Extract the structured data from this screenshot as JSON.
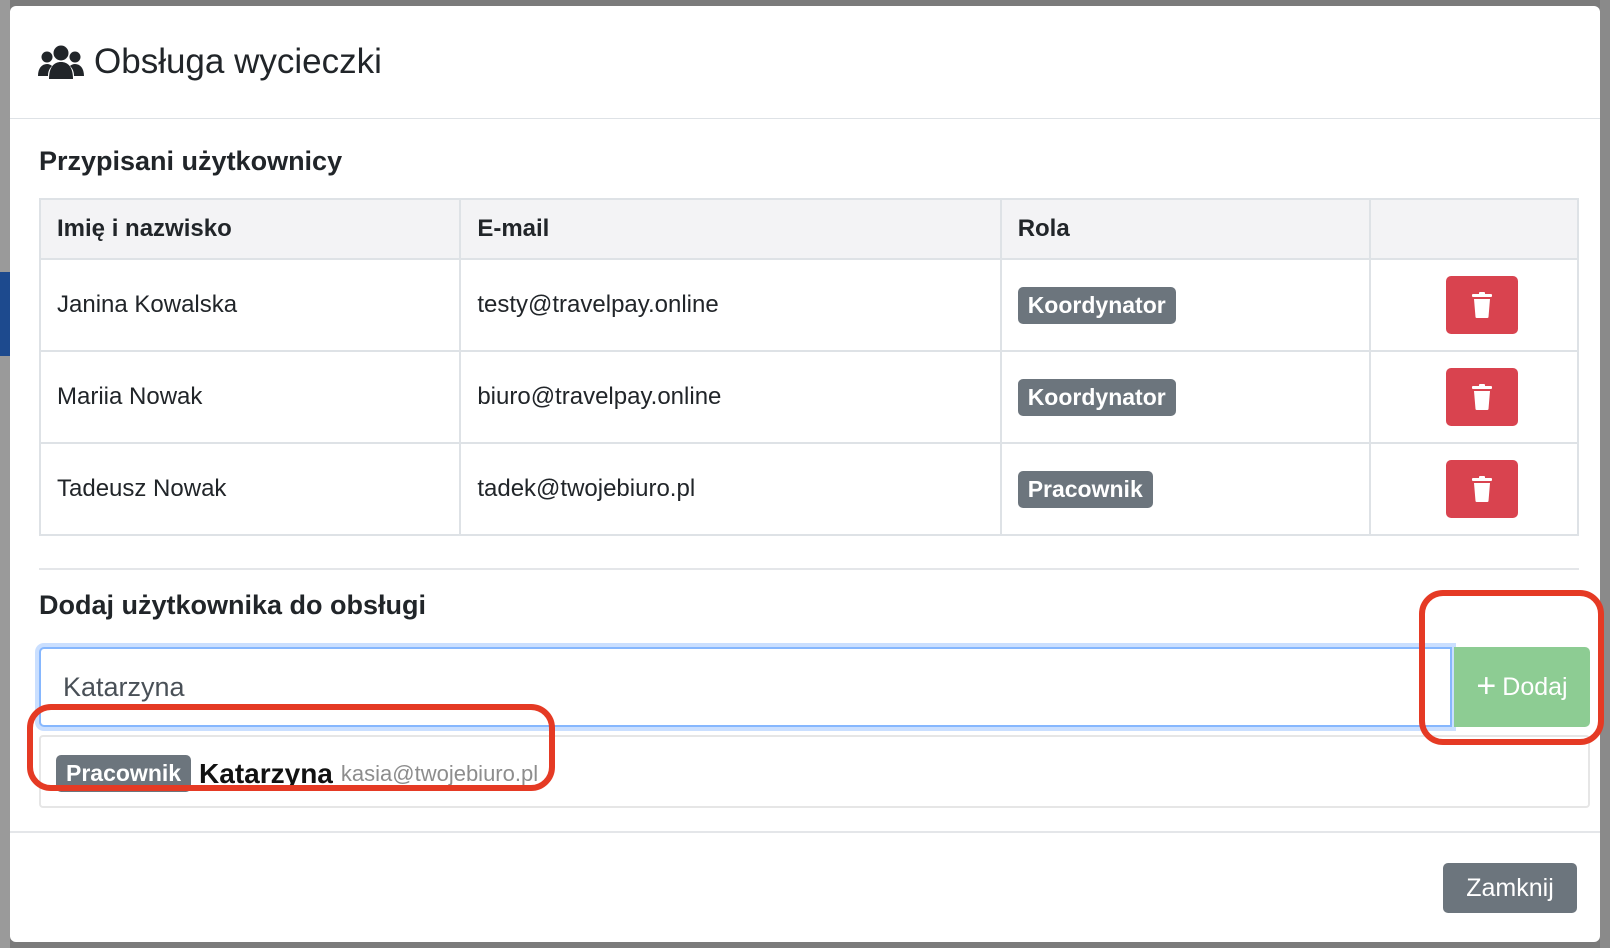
{
  "modal": {
    "title": "Obsługa wycieczki",
    "icon": "users-icon"
  },
  "assigned": {
    "title": "Przypisani użytkownicy",
    "columns": [
      "Imię i nazwisko",
      "E-mail",
      "Rola",
      ""
    ],
    "rows": [
      {
        "name": "Janina Kowalska",
        "email": "testy@travelpay.online",
        "role": "Koordynator"
      },
      {
        "name": "Mariia Nowak",
        "email": "biuro@travelpay.online",
        "role": "Koordynator"
      },
      {
        "name": "Tadeusz Nowak",
        "email": "tadek@twojebiuro.pl",
        "role": "Pracownik"
      }
    ],
    "delete_icon": "trash-icon"
  },
  "add_user": {
    "title": "Dodaj użytkownika do obsługi",
    "input_value": "Katarzyna",
    "add_button_label": "Dodaj",
    "add_icon": "plus-icon",
    "suggestion": {
      "role": "Pracownik",
      "name": "Katarzyna",
      "email": "kasia@twojebiuro.pl"
    }
  },
  "footer": {
    "close_label": "Zamknij"
  },
  "colors": {
    "danger": "#d9434f",
    "success_disabled": "#8dcc93",
    "secondary": "#6c757d",
    "annotation": "#e53a24"
  }
}
